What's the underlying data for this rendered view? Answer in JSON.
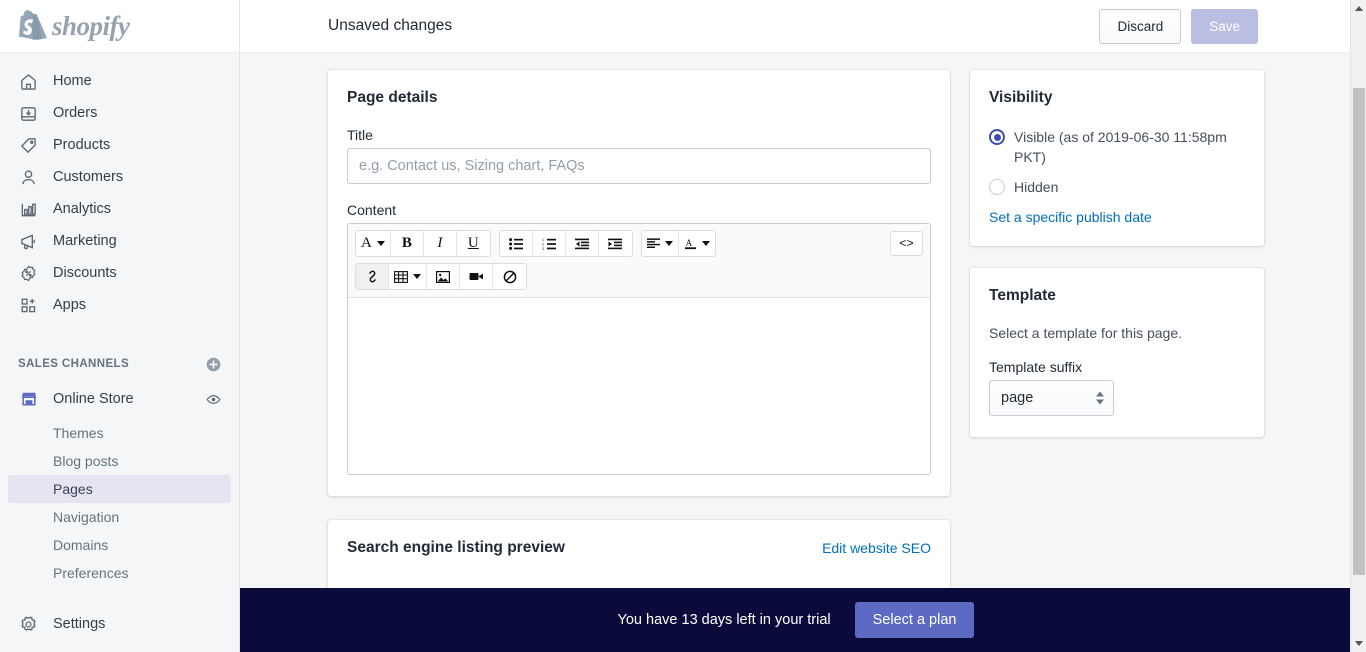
{
  "brand": {
    "name": "shopify",
    "logo_icon": "shopify-bag-icon"
  },
  "sidebar": {
    "nav": [
      {
        "label": "Home",
        "icon": "home-icon"
      },
      {
        "label": "Orders",
        "icon": "orders-inbox-icon"
      },
      {
        "label": "Products",
        "icon": "product-tag-icon"
      },
      {
        "label": "Customers",
        "icon": "customer-person-icon"
      },
      {
        "label": "Analytics",
        "icon": "analytics-bars-icon"
      },
      {
        "label": "Marketing",
        "icon": "marketing-megaphone-icon"
      },
      {
        "label": "Discounts",
        "icon": "discounts-percent-icon"
      },
      {
        "label": "Apps",
        "icon": "apps-plus-icon"
      }
    ],
    "sales_channels_header": "SALES CHANNELS",
    "add_channel_icon": "plus-circle-icon",
    "channel": {
      "label": "Online Store",
      "icon": "storefront-icon",
      "view_icon": "eye-icon"
    },
    "sub_items": [
      {
        "label": "Themes",
        "active": false
      },
      {
        "label": "Blog posts",
        "active": false
      },
      {
        "label": "Pages",
        "active": true
      },
      {
        "label": "Navigation",
        "active": false
      },
      {
        "label": "Domains",
        "active": false
      },
      {
        "label": "Preferences",
        "active": false
      }
    ],
    "settings": {
      "label": "Settings",
      "icon": "gear-icon"
    }
  },
  "topbar": {
    "title": "Unsaved changes",
    "discard_label": "Discard",
    "save_label": "Save",
    "save_disabled": true
  },
  "page_details": {
    "card_title": "Page details",
    "title_label": "Title",
    "title_value": "",
    "title_placeholder": "e.g. Contact us, Sizing chart, FAQs",
    "content_label": "Content",
    "content_value": "",
    "toolbar": {
      "row1": [
        {
          "icon": "font-family-icon",
          "glyph": "A",
          "caret": true
        },
        {
          "icon": "bold-icon",
          "glyph": "B",
          "caret": false
        },
        {
          "icon": "italic-icon",
          "glyph": "I",
          "caret": false
        },
        {
          "icon": "underline-icon",
          "glyph": "U",
          "caret": false
        },
        {
          "icon": "bulleted-list-icon",
          "glyph": "",
          "caret": false
        },
        {
          "icon": "numbered-list-icon",
          "glyph": "",
          "caret": false
        },
        {
          "icon": "outdent-icon",
          "glyph": "",
          "caret": false
        },
        {
          "icon": "indent-icon",
          "glyph": "",
          "caret": false
        },
        {
          "icon": "align-icon",
          "glyph": "",
          "caret": true
        },
        {
          "icon": "text-color-icon",
          "glyph": "A",
          "caret": true
        }
      ],
      "row2": [
        {
          "icon": "link-icon",
          "glyph": "",
          "caret": false
        },
        {
          "icon": "table-icon",
          "glyph": "",
          "caret": true
        },
        {
          "icon": "insert-image-icon",
          "glyph": "",
          "caret": false
        },
        {
          "icon": "insert-video-icon",
          "glyph": "",
          "caret": false
        },
        {
          "icon": "clear-formatting-icon",
          "glyph": "",
          "caret": false
        }
      ],
      "code_view": {
        "icon": "code-view-icon",
        "glyph": "<>"
      }
    }
  },
  "seo": {
    "title": "Search engine listing preview",
    "edit_link": "Edit website SEO"
  },
  "visibility": {
    "card_title": "Visibility",
    "options": [
      {
        "label": "Visible (as of 2019-06-30 11:58pm PKT)",
        "checked": true
      },
      {
        "label": "Hidden",
        "checked": false
      }
    ],
    "publish_link": "Set a specific publish date"
  },
  "template": {
    "card_title": "Template",
    "hint": "Select a template for this page.",
    "suffix_label": "Template suffix",
    "suffix_value": "page",
    "suffix_options": [
      "page"
    ]
  },
  "banner": {
    "text": "You have 13 days left in your trial",
    "button_label": "Select a plan"
  },
  "colors": {
    "accent": "#5c6ac4",
    "radio_selected": "#3f4eae",
    "link": "#006fbb",
    "banner_bg": "#0b0b3b",
    "app_bg": "#f4f6f8",
    "active_nav_bg": "#e4e5f0"
  },
  "scrollbar": {
    "up_icon": "scroll-up-arrow-icon",
    "down_icon": "scroll-down-arrow-icon"
  }
}
